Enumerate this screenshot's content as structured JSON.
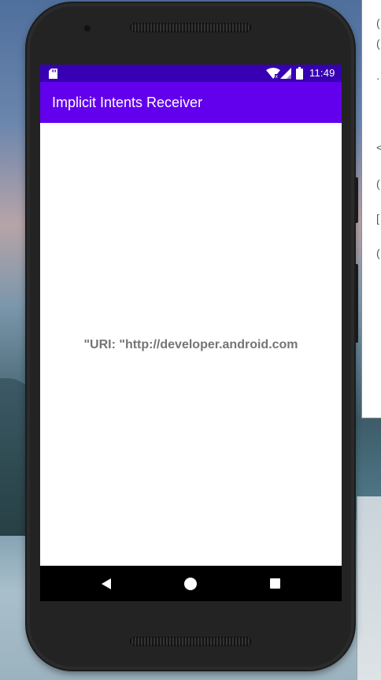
{
  "status_bar": {
    "time": "11:49"
  },
  "app_bar": {
    "title": "Implicit Intents Receiver"
  },
  "content": {
    "uri_text": "\"URI: \"http://developer.android.com"
  },
  "colors": {
    "status_bar": "#3700b3",
    "app_bar": "#6200ee",
    "text": "#757575",
    "nav_bar": "#000000"
  },
  "icons": {
    "status": [
      "sd-card-icon",
      "wifi-icon",
      "signal-icon",
      "battery-icon"
    ],
    "nav": [
      "back-icon",
      "home-icon",
      "recents-icon"
    ]
  }
}
